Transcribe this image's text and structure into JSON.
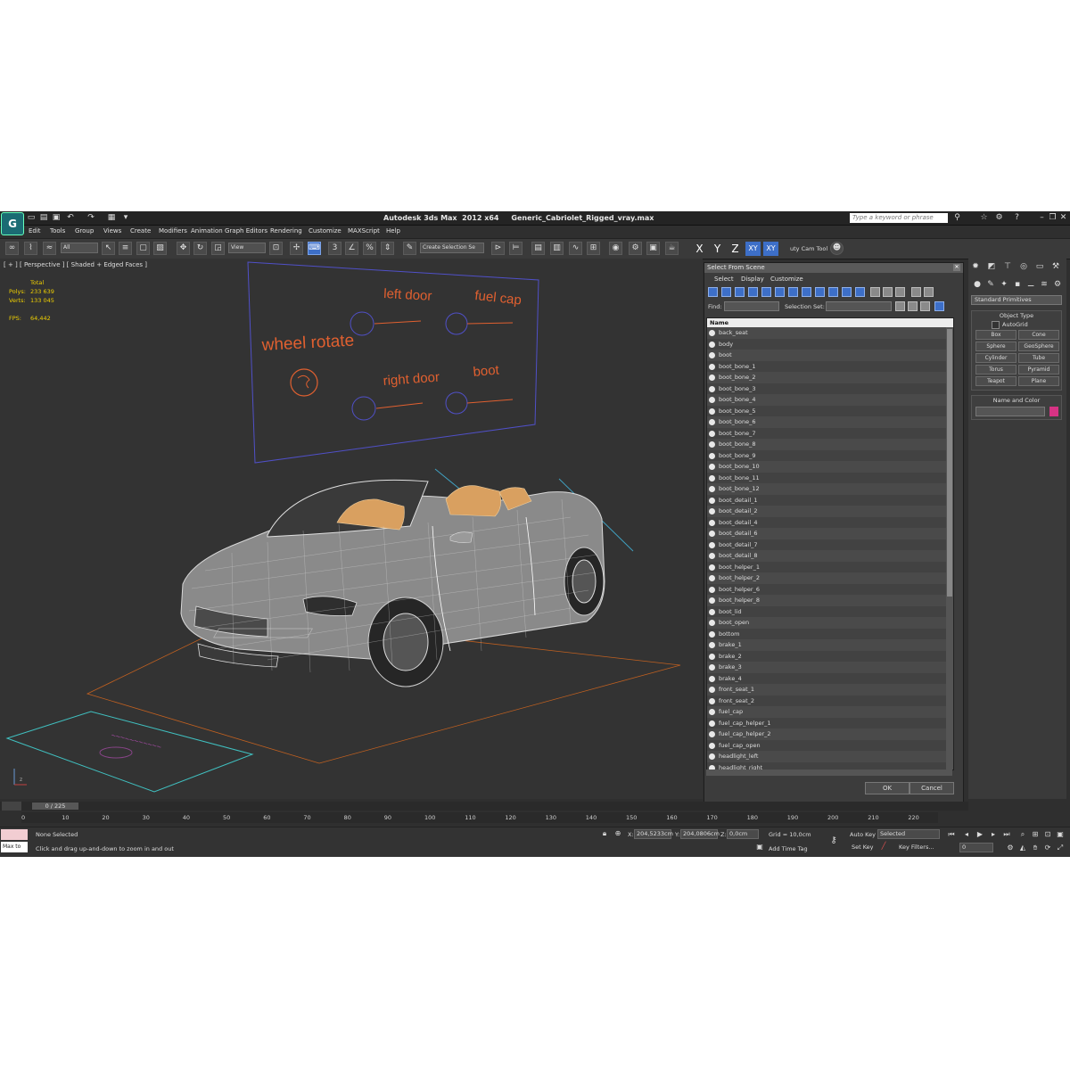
{
  "window": {
    "title": "Autodesk 3ds Max  2012 x64     Generic_Cabriolet_Rigged_vray.max",
    "search_placeholder": "Type a keyword or phrase"
  },
  "menu": [
    "Edit",
    "Tools",
    "Group",
    "Views",
    "Create",
    "Modifiers",
    "Animation",
    "Graph Editors",
    "Rendering",
    "Customize",
    "MAXScript",
    "Help"
  ],
  "toolbar": {
    "filter_value": "All",
    "ref_coord_value": "View",
    "selection_set_placeholder": "Create Selection Se",
    "axis_x": "X",
    "axis_y": "Y",
    "axis_z": "Z",
    "axis_xy": "XY",
    "axis_xy2": "XY",
    "utility_label": "uty Cam Tool"
  },
  "viewport": {
    "label": "[ + ] [ Perspective ] [ Shaded + Edged Faces ]",
    "stats_header": "Total",
    "polys_label": "Polys:",
    "polys_value": "233 639",
    "verts_label": "Verts:",
    "verts_value": "133 045",
    "fps_label": "FPS:",
    "fps_value": "64,442",
    "rig_labels": {
      "left_door": "left door",
      "fuel_cap": "fuel cap",
      "wheel_rotate": "wheel rotate",
      "right_door": "right door",
      "boot": "boot"
    },
    "colors": {
      "background": "#333333",
      "rig_text": "#e06030",
      "rig_frame": "#5050c8",
      "car_wire": "#d8d8d8",
      "seat": "#d9a060",
      "helper": "#40c0c0",
      "ground": "#c06020"
    }
  },
  "dialog": {
    "title": "Select From Scene",
    "menu": [
      "Select",
      "Display",
      "Customize"
    ],
    "find_label": "Find:",
    "selection_set_label": "Selection Set:",
    "column_name": "Name",
    "ok_label": "OK",
    "cancel_label": "Cancel",
    "objects": [
      "back_seat",
      "body",
      "boot",
      "boot_bone_1",
      "boot_bone_2",
      "boot_bone_3",
      "boot_bone_4",
      "boot_bone_5",
      "boot_bone_6",
      "boot_bone_7",
      "boot_bone_8",
      "boot_bone_9",
      "boot_bone_10",
      "boot_bone_11",
      "boot_bone_12",
      "boot_detail_1",
      "boot_detail_2",
      "boot_detail_4",
      "boot_detail_6",
      "boot_detail_7",
      "boot_detail_8",
      "boot_helper_1",
      "boot_helper_2",
      "boot_helper_6",
      "boot_helper_8",
      "boot_lid",
      "boot_open",
      "bottom",
      "brake_1",
      "brake_2",
      "brake_3",
      "brake_4",
      "front_seat_1",
      "front_seat_2",
      "fuel_cap",
      "fuel_cap_helper_1",
      "fuel_cap_helper_2",
      "fuel_cap_open",
      "headlight_left",
      "headlight_right"
    ]
  },
  "command_panel": {
    "category_value": "Standard Primitives",
    "object_type_title": "Object Type",
    "autogrid_label": "AutoGrid",
    "object_buttons": [
      "Box",
      "Cone",
      "Sphere",
      "GeoSphere",
      "Cylinder",
      "Tube",
      "Torus",
      "Pyramid",
      "Teapot",
      "Plane"
    ],
    "name_color_title": "Name and Color",
    "swatch_color": "#d63384"
  },
  "timeline": {
    "frame_indicator": "0 / 225",
    "ticks": [
      "0",
      "10",
      "20",
      "30",
      "40",
      "50",
      "60",
      "70",
      "80",
      "90",
      "100",
      "110",
      "120",
      "130",
      "140",
      "150",
      "160",
      "170",
      "180",
      "190",
      "200",
      "210",
      "220"
    ]
  },
  "status": {
    "maxscript_text": "Max to",
    "selection_status": "None Selected",
    "prompt": "Click and drag up-and-down to zoom in and out",
    "x_label": "X:",
    "x_value": "204,5233cm",
    "y_label": "Y:",
    "y_value": "204,0806cm",
    "z_label": "Z:",
    "z_value": "0,0cm",
    "grid": "Grid = 10,0cm",
    "add_time_tag": "Add Time Tag",
    "auto_key": "Auto Key",
    "auto_key_mode": "Selected",
    "set_key": "Set Key",
    "key_filters": "Key Filters...",
    "current_frame": "0"
  }
}
